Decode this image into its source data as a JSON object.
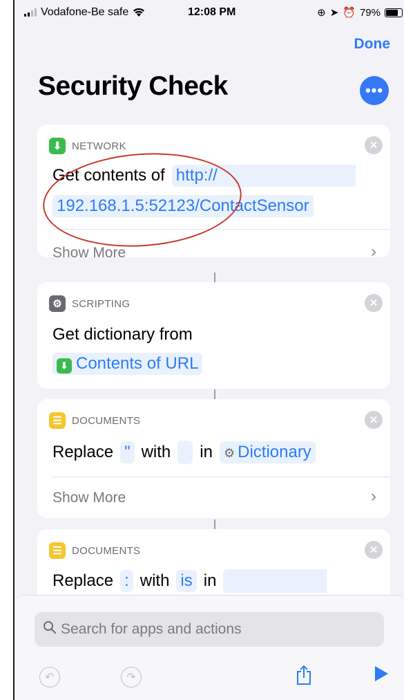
{
  "status_bar": {
    "carrier": "Vodafone-Be safe",
    "time": "12:08 PM",
    "battery": "79%",
    "battery_level": 0.79
  },
  "header": {
    "done_label": "Done",
    "title": "Security Check",
    "more_glyph": "•••"
  },
  "actions": [
    {
      "category": "NETWORK",
      "icon": "download-arrow-icon",
      "icon_color": "#3bbb4e",
      "text_prefix": "Get contents of",
      "url_line1": "http://",
      "url_line2": "192.168.1.5:52123/ContactSensor",
      "show_more": "Show More"
    },
    {
      "category": "SCRIPTING",
      "icon": "gear-icon",
      "icon_color": "#6a6a70",
      "text_prefix": "Get dictionary from",
      "token": "Contents of URL"
    },
    {
      "category": "DOCUMENTS",
      "icon": "document-icon",
      "icon_color": "#f6c62e",
      "word_replace": "Replace",
      "token_find": "\"",
      "word_with": "with",
      "word_in": "in",
      "token_target": "Dictionary",
      "show_more": "Show More"
    },
    {
      "category": "DOCUMENTS",
      "icon": "document-icon",
      "icon_color": "#f6c62e",
      "word_replace": "Replace",
      "token_find": ":",
      "word_with": "with",
      "token_replace": "is",
      "word_in": "in"
    }
  ],
  "search": {
    "placeholder": "Search for apps and actions"
  },
  "colors": {
    "accent": "#2d7cf6",
    "annotation": "#c8382c"
  }
}
